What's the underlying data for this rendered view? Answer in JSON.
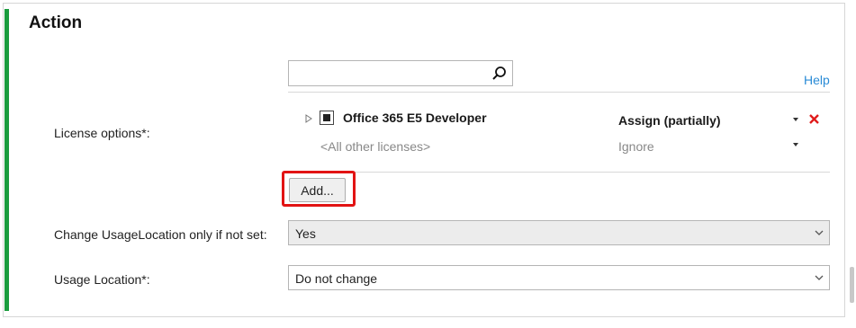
{
  "section": {
    "title": "Action"
  },
  "search": {
    "value": "",
    "placeholder": ""
  },
  "help": {
    "label": "Help"
  },
  "license_options": {
    "label": "License options*:",
    "licenses": [
      {
        "name": "Office 365 E5 Developer",
        "action": "Assign (partially)"
      },
      {
        "name": "<All other licenses>",
        "action": "Ignore"
      }
    ],
    "add_label": "Add..."
  },
  "usage_location_change": {
    "label": "Change UsageLocation only if not set:",
    "selected": "Yes"
  },
  "usage_location": {
    "label": "Usage Location*:",
    "selected": "Do not change"
  },
  "colors": {
    "accent": "#1a9c3e",
    "highlight": "#e21313",
    "link": "#2a8bd6",
    "remove": "#e01b1b"
  }
}
